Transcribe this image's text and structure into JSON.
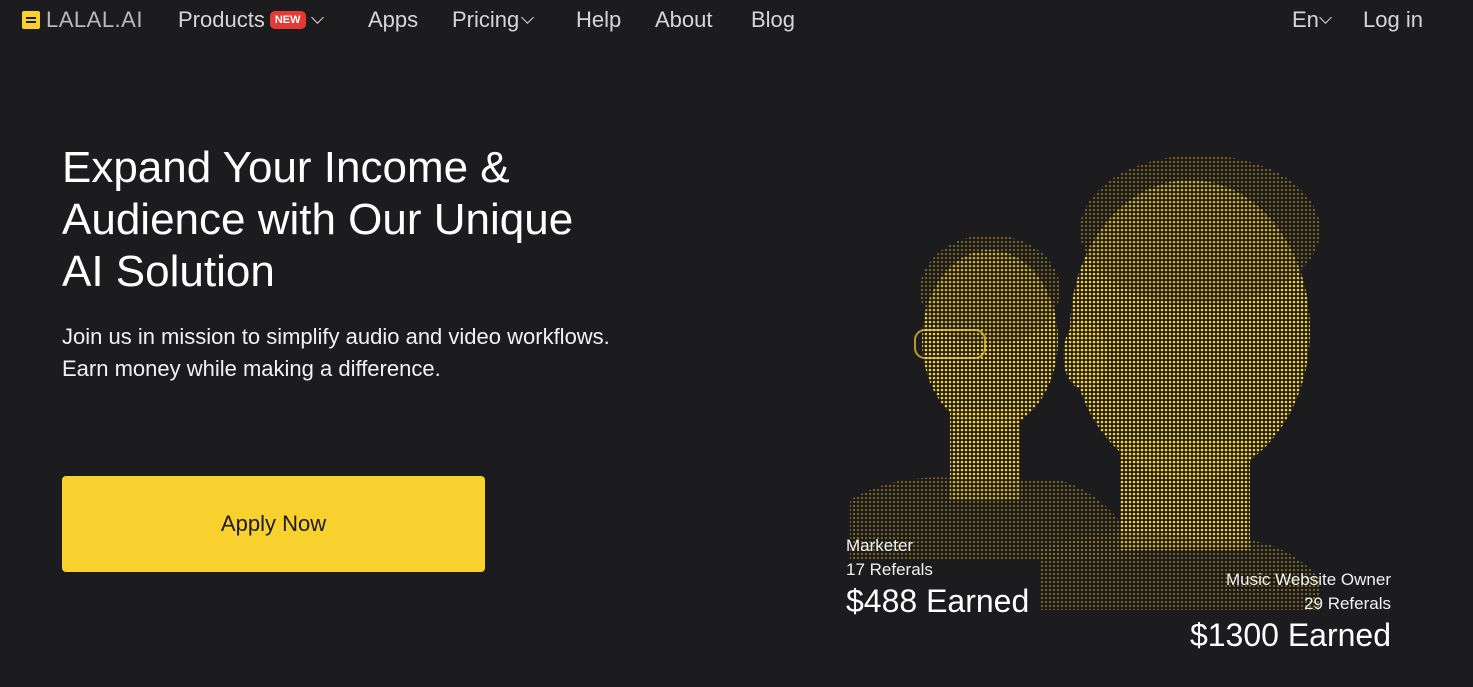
{
  "nav": {
    "logo_text": "LALAL.AI",
    "items": [
      {
        "label": "Products",
        "badge": "NEW"
      },
      {
        "label": "Apps"
      },
      {
        "label": "Pricing"
      },
      {
        "label": "Help"
      },
      {
        "label": "About"
      },
      {
        "label": "Blog"
      }
    ],
    "language": "En",
    "login": "Log in"
  },
  "hero": {
    "title": "Expand Your Income & Audience with Our Unique AI Solution",
    "subtitle": "Join us in mission to simplify audio and video workflows. Earn money while making a difference.",
    "cta": "Apply Now"
  },
  "stats": [
    {
      "role": "Marketer",
      "referrals": "17 Referals",
      "earned": "$488 Earned"
    },
    {
      "role": "Music Website Owner",
      "referrals": "29 Referals",
      "earned": "$1300 Earned"
    }
  ],
  "colors": {
    "background": "#1c1b1e",
    "accent": "#f8d12e",
    "badge": "#e53935"
  }
}
